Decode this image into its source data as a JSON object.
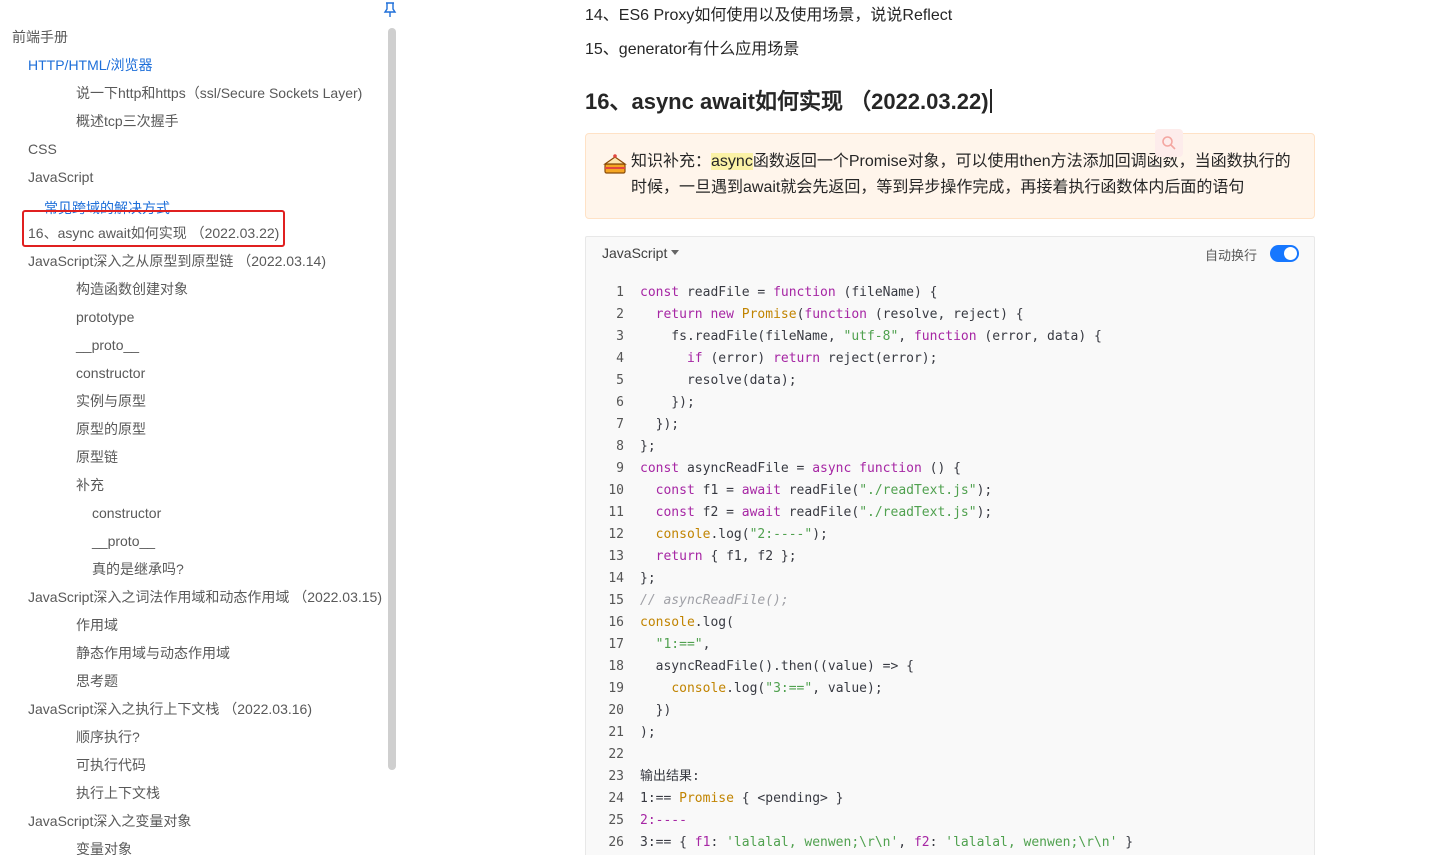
{
  "sidebar": {
    "items": [
      {
        "label": "前端手册",
        "level": "l0",
        "style": ""
      },
      {
        "label": "HTTP/HTML/浏览器",
        "level": "l1",
        "style": "link"
      },
      {
        "label": "说一下http和https（ssl/Secure Sockets Layer)",
        "level": "l2",
        "style": ""
      },
      {
        "label": "概述tcp三次握手",
        "level": "l2",
        "style": ""
      },
      {
        "label": "CSS",
        "level": "l1",
        "style": ""
      },
      {
        "label": "JavaScript",
        "level": "l1",
        "style": ""
      },
      {
        "label": "常见跨域的解决方式",
        "level": "l1b",
        "style": "cut"
      },
      {
        "label": "16、async await如何实现 （2022.03.22)",
        "level": "l1",
        "style": ""
      },
      {
        "label": "JavaScript深入之从原型到原型链 （2022.03.14)",
        "level": "l1",
        "style": ""
      },
      {
        "label": "构造函数创建对象",
        "level": "l2",
        "style": ""
      },
      {
        "label": "prototype",
        "level": "l2",
        "style": ""
      },
      {
        "label": "__proto__",
        "level": "l2",
        "style": ""
      },
      {
        "label": "constructor",
        "level": "l2",
        "style": ""
      },
      {
        "label": "实例与原型",
        "level": "l2",
        "style": ""
      },
      {
        "label": "原型的原型",
        "level": "l2",
        "style": ""
      },
      {
        "label": "原型链",
        "level": "l2",
        "style": ""
      },
      {
        "label": "补充",
        "level": "l2",
        "style": ""
      },
      {
        "label": "constructor",
        "level": "l3",
        "style": ""
      },
      {
        "label": "__proto__",
        "level": "l3",
        "style": ""
      },
      {
        "label": "真的是继承吗?",
        "level": "l3",
        "style": ""
      },
      {
        "label": "JavaScript深入之词法作用域和动态作用域 （2022.03.15)",
        "level": "l1",
        "style": ""
      },
      {
        "label": "作用域",
        "level": "l2",
        "style": ""
      },
      {
        "label": "静态作用域与动态作用域",
        "level": "l2",
        "style": ""
      },
      {
        "label": "思考题",
        "level": "l2",
        "style": ""
      },
      {
        "label": "JavaScript深入之执行上下文栈 （2022.03.16)",
        "level": "l1",
        "style": ""
      },
      {
        "label": "顺序执行?",
        "level": "l2",
        "style": ""
      },
      {
        "label": "可执行代码",
        "level": "l2",
        "style": ""
      },
      {
        "label": "执行上下文栈",
        "level": "l2",
        "style": ""
      },
      {
        "label": "JavaScript深入之变量对象",
        "level": "l1",
        "style": ""
      },
      {
        "label": "变量对象",
        "level": "l2",
        "style": ""
      }
    ],
    "highlight_color": "#e02020"
  },
  "main": {
    "line14": "14、ES6 Proxy如何使用以及使用场景，说说Reflect",
    "line15": "15、generator有什么应用场景",
    "heading": "16、async await如何实现 （2022.03.22)",
    "tip": {
      "prefix": "知识补充：",
      "mark": "async",
      "rest": "函数返回一个Promise对象，可以使用then方法添加回调函数，当函数执行的时候，一旦遇到await就会先返回，等到异步操作完成，再接着执行函数体内后面的语句",
      "icon": "cake-icon"
    },
    "code": {
      "language": "JavaScript",
      "wrap_label": "自动换行",
      "wrap_on": true,
      "accent": "#1677ff",
      "lines": [
        [
          [
            "k",
            "const"
          ],
          [
            "x",
            " readFile = "
          ],
          [
            "k",
            "function"
          ],
          [
            "x",
            " (fileName) {"
          ]
        ],
        [
          [
            "x",
            "  "
          ],
          [
            "k",
            "return"
          ],
          [
            "x",
            " "
          ],
          [
            "k",
            "new"
          ],
          [
            "x",
            " "
          ],
          [
            "b",
            "Promise"
          ],
          [
            "x",
            "("
          ],
          [
            "k",
            "function"
          ],
          [
            "x",
            " (resolve, reject) {"
          ]
        ],
        [
          [
            "x",
            "    fs.readFile(fileName, "
          ],
          [
            "s",
            "\"utf-8\""
          ],
          [
            "x",
            ", "
          ],
          [
            "k",
            "function"
          ],
          [
            "x",
            " (error, data) {"
          ]
        ],
        [
          [
            "x",
            "      "
          ],
          [
            "k",
            "if"
          ],
          [
            "x",
            " (error) "
          ],
          [
            "k",
            "return"
          ],
          [
            "x",
            " reject(error);"
          ]
        ],
        [
          [
            "x",
            "      resolve(data);"
          ]
        ],
        [
          [
            "x",
            "    });"
          ]
        ],
        [
          [
            "x",
            "  });"
          ]
        ],
        [
          [
            "x",
            "};"
          ]
        ],
        [
          [
            "k",
            "const"
          ],
          [
            "x",
            " asyncReadFile = "
          ],
          [
            "k",
            "async"
          ],
          [
            "x",
            " "
          ],
          [
            "k",
            "function"
          ],
          [
            "x",
            " () {"
          ]
        ],
        [
          [
            "x",
            "  "
          ],
          [
            "k",
            "const"
          ],
          [
            "x",
            " f1 = "
          ],
          [
            "k",
            "await"
          ],
          [
            "x",
            " readFile("
          ],
          [
            "s",
            "\"./readText.js\""
          ],
          [
            "x",
            ");"
          ]
        ],
        [
          [
            "x",
            "  "
          ],
          [
            "k",
            "const"
          ],
          [
            "x",
            " f2 = "
          ],
          [
            "k",
            "await"
          ],
          [
            "x",
            " readFile("
          ],
          [
            "s",
            "\"./readText.js\""
          ],
          [
            "x",
            ");"
          ]
        ],
        [
          [
            "x",
            "  "
          ],
          [
            "b",
            "console"
          ],
          [
            "x",
            ".log("
          ],
          [
            "s",
            "\"2:----\""
          ],
          [
            "x",
            ");"
          ]
        ],
        [
          [
            "x",
            "  "
          ],
          [
            "k",
            "return"
          ],
          [
            "x",
            " { f1, f2 };"
          ]
        ],
        [
          [
            "x",
            "};"
          ]
        ],
        [
          [
            "c",
            "// asyncReadFile();"
          ]
        ],
        [
          [
            "b",
            "console"
          ],
          [
            "x",
            ".log("
          ]
        ],
        [
          [
            "x",
            "  "
          ],
          [
            "s",
            "\"1:==\""
          ],
          [
            "x",
            ","
          ]
        ],
        [
          [
            "x",
            "  asyncReadFile().then((value) => {"
          ]
        ],
        [
          [
            "x",
            "    "
          ],
          [
            "b",
            "console"
          ],
          [
            "x",
            ".log("
          ],
          [
            "s",
            "\"3:==\""
          ],
          [
            "x",
            ", value);"
          ]
        ],
        [
          [
            "x",
            "  })"
          ]
        ],
        [
          [
            "x",
            ");"
          ]
        ],
        [
          [
            "x",
            ""
          ]
        ],
        [
          [
            "x",
            "输出结果:"
          ]
        ],
        [
          [
            "x",
            "1:== "
          ],
          [
            "b",
            "Promise"
          ],
          [
            "x",
            " { <pending> }"
          ]
        ],
        [
          [
            "k",
            "2:----"
          ]
        ],
        [
          [
            "x",
            "3:== { "
          ],
          [
            "k",
            "f1"
          ],
          [
            "x",
            ": "
          ],
          [
            "s",
            "'lalalal, wenwen;\\r\\n'"
          ],
          [
            "x",
            ", "
          ],
          [
            "k",
            "f2"
          ],
          [
            "x",
            ": "
          ],
          [
            "s",
            "'lalalal, wenwen;\\r\\n'"
          ],
          [
            "x",
            " }"
          ]
        ]
      ]
    }
  }
}
